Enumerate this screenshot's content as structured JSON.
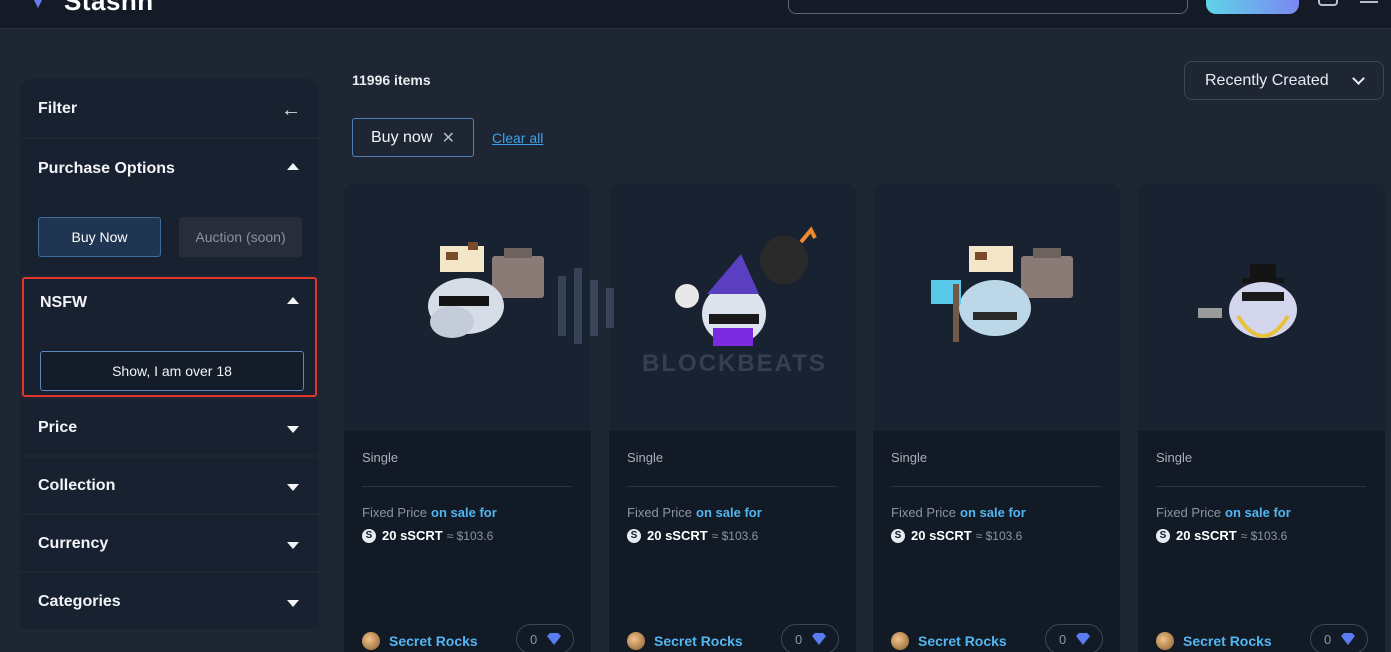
{
  "brand": {
    "name": "Stashh"
  },
  "sidebar": {
    "filter_title": "Filter",
    "purchase_title": "Purchase Options",
    "buy_now_label": "Buy Now",
    "auction_label": "Auction (soon)",
    "nsfw_title": "NSFW",
    "nsfw_button": "Show, I am over 18",
    "price_title": "Price",
    "collection_title": "Collection",
    "currency_title": "Currency",
    "categories_title": "Categories"
  },
  "main": {
    "items_count": "11996 items",
    "sort_label": "Recently Created",
    "chip_label": "Buy now",
    "clear_all": "Clear all"
  },
  "watermark": {
    "text": "BLOCKBEATS"
  },
  "cards": [
    {
      "type": "Single",
      "price_label": "Fixed Price",
      "sale": "on sale for",
      "price": "20 sSCRT",
      "usd": "≈ $103.6",
      "owner": "Secret Rocks",
      "likes": "0"
    },
    {
      "type": "Single",
      "price_label": "Fixed Price",
      "sale": "on sale for",
      "price": "20 sSCRT",
      "usd": "≈ $103.6",
      "owner": "Secret Rocks",
      "likes": "0"
    },
    {
      "type": "Single",
      "price_label": "Fixed Price",
      "sale": "on sale for",
      "price": "20 sSCRT",
      "usd": "≈ $103.6",
      "owner": "Secret Rocks",
      "likes": "0"
    },
    {
      "type": "Single",
      "price_label": "Fixed Price",
      "sale": "on sale for",
      "price": "20 sSCRT",
      "usd": "≈ $103.6",
      "owner": "Secret Rocks",
      "likes": "0"
    }
  ],
  "colors": {
    "accent": "#52b6f0",
    "highlight": "#e5342a",
    "background": "#1e2634"
  }
}
